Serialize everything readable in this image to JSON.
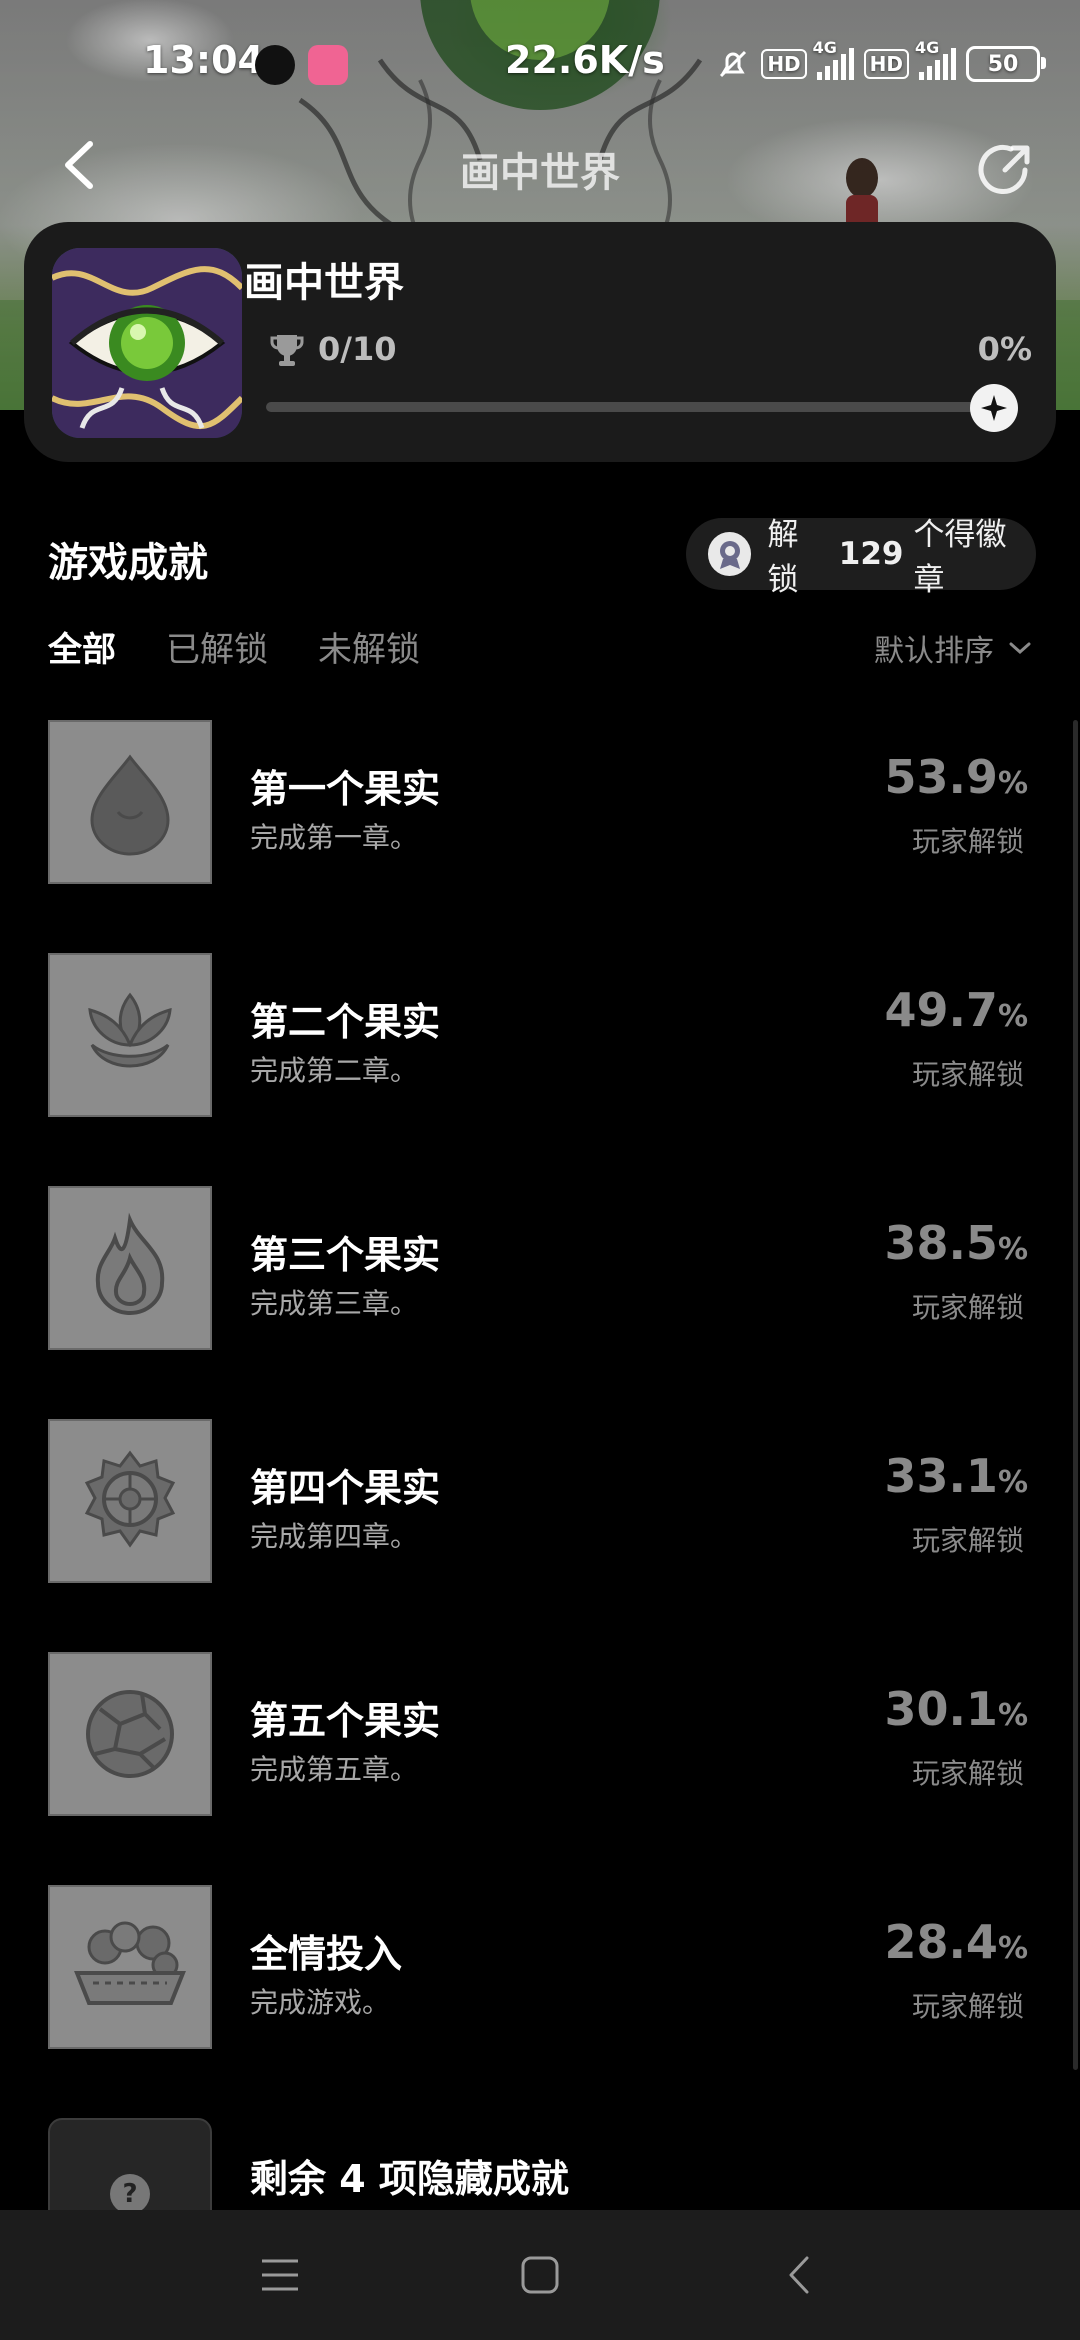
{
  "status_bar": {
    "time": "13:04",
    "network_speed": "22.6K/s",
    "hd_label": "HD",
    "network_type": "4G",
    "battery": "50"
  },
  "nav": {
    "title": "画中世界"
  },
  "game": {
    "name": "画中世界",
    "achievements_progress": "0/10",
    "percent": "0%",
    "progress": 0
  },
  "section": {
    "title": "游戏成就",
    "badge_prefix": "解锁",
    "badge_count": "129",
    "badge_suffix": "个得徽章"
  },
  "tabs": [
    {
      "label": "全部",
      "active": true
    },
    {
      "label": "已解锁",
      "active": false
    },
    {
      "label": "未解锁",
      "active": false
    }
  ],
  "sort": {
    "label": "默认排序"
  },
  "achievements": [
    {
      "title": "第一个果实",
      "desc": "完成第一章。",
      "rate": "53.9",
      "unit": "%",
      "sub": "玩家解锁",
      "icon": "fruit-drop-icon"
    },
    {
      "title": "第二个果实",
      "desc": "完成第二章。",
      "rate": "49.7",
      "unit": "%",
      "sub": "玩家解锁",
      "icon": "lotus-icon"
    },
    {
      "title": "第三个果实",
      "desc": "完成第三章。",
      "rate": "38.5",
      "unit": "%",
      "sub": "玩家解锁",
      "icon": "flame-icon"
    },
    {
      "title": "第四个果实",
      "desc": "完成第四章。",
      "rate": "33.1",
      "unit": "%",
      "sub": "玩家解锁",
      "icon": "gear-flower-icon"
    },
    {
      "title": "第五个果实",
      "desc": "完成第五章。",
      "rate": "30.1",
      "unit": "%",
      "sub": "玩家解锁",
      "icon": "cracked-orb-icon"
    },
    {
      "title": "全情投入",
      "desc": "完成游戏。",
      "rate": "28.4",
      "unit": "%",
      "sub": "玩家解锁",
      "icon": "fruit-bowl-icon"
    }
  ],
  "hidden": {
    "title": "剩余 4 项隐藏成就",
    "mark": "?"
  }
}
